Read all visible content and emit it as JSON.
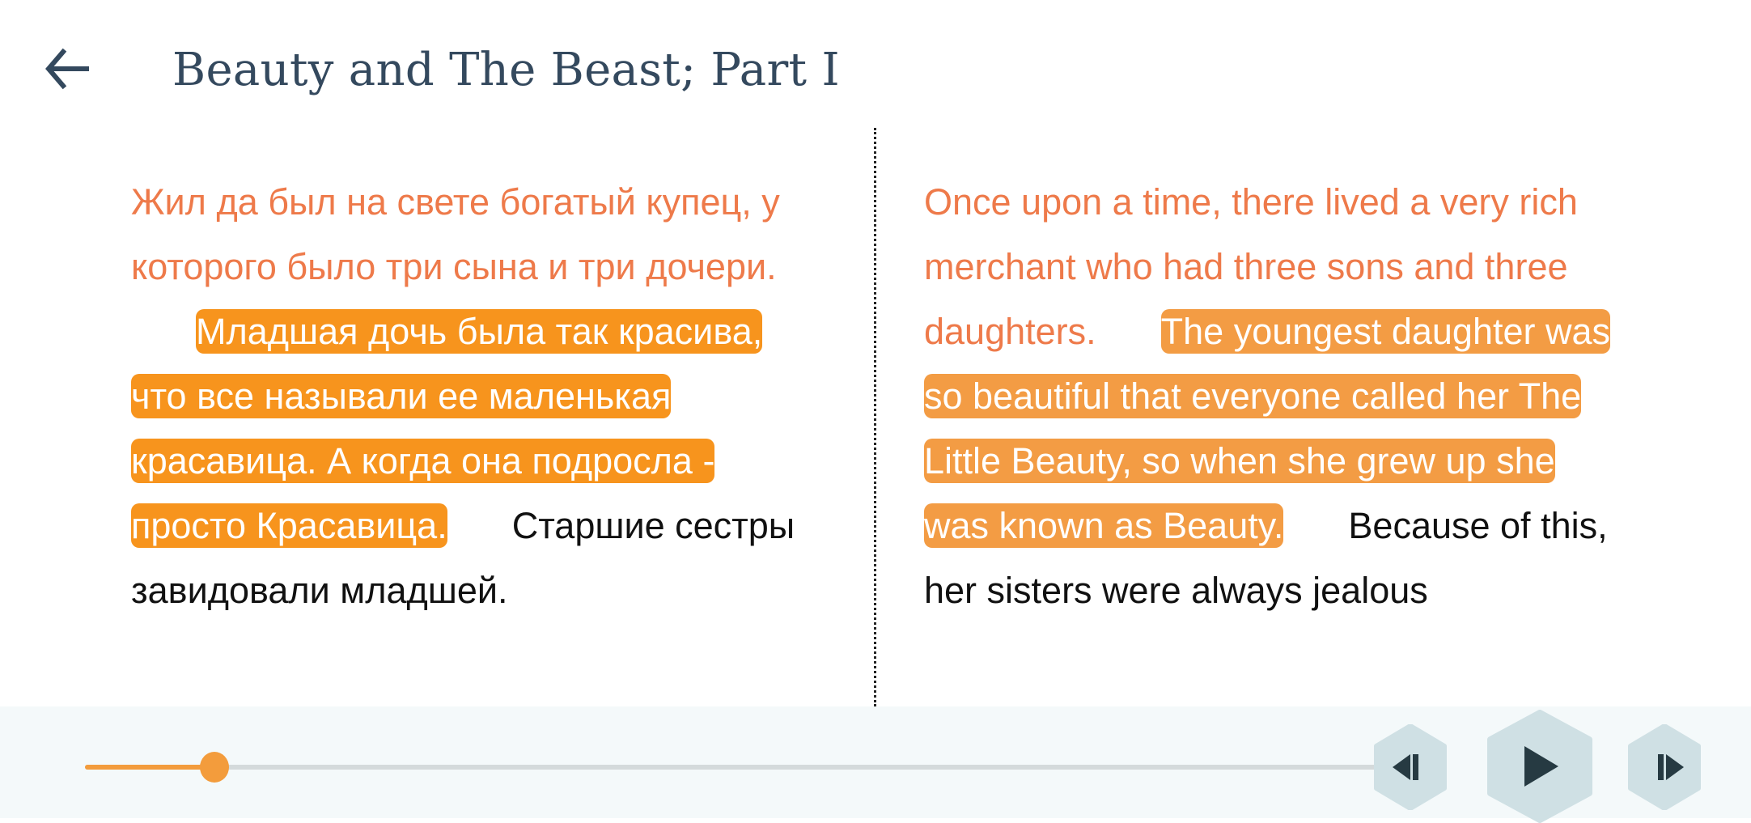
{
  "header": {
    "back_icon": "arrow-left-icon",
    "title": "Beauty and The Beast; Part I"
  },
  "left_column": {
    "language": "ru",
    "read": [
      "Жил да был на свете богатый купец, у которого было три сына и три дочери."
    ],
    "active": "Младшая дочь была так красива, что все называли ее маленькая красавица. А когда она подросла - просто Красавица.",
    "unread": "Старшие сестры завидовали младшей."
  },
  "right_column": {
    "language": "en",
    "read": [
      "Once upon a time, there lived a very rich merchant who had three sons and three daughters."
    ],
    "active": "The youngest daughter was so beautiful that everyone called her The Little Beauty, so when she grew up she was known as Beauty.",
    "unread": "Because of this, her sisters were always jealous"
  },
  "player": {
    "progress_percent": 10,
    "prev_icon": "skip-back-icon",
    "play_icon": "play-icon",
    "next_icon": "skip-forward-icon"
  },
  "colors": {
    "title": "#34495e",
    "read_text": "#ee7a4a",
    "active_highlight_left": "#f7941d",
    "active_highlight_right": "#f39c44",
    "unread_text": "#111111",
    "slider_fill": "#f39c3c",
    "slider_track": "#d4dadb",
    "control_bg": "#cfe0e4",
    "control_icon": "#263a42",
    "player_bg": "#f4f9fa"
  }
}
